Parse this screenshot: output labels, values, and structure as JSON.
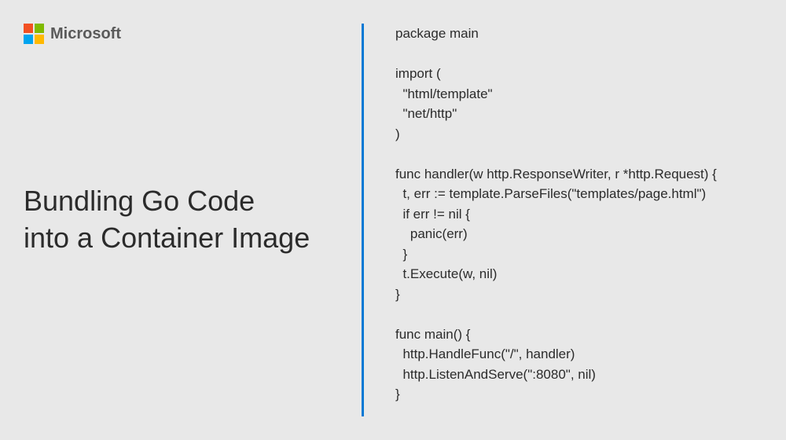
{
  "brand": {
    "name": "Microsoft",
    "colors": {
      "red": "#f25022",
      "green": "#7fba00",
      "blue": "#00a4ef",
      "yellow": "#ffb900"
    }
  },
  "slide": {
    "title": "Bundling Go Code\ninto a Container Image",
    "code": "package main\n\nimport (\n  \"html/template\"\n  \"net/http\"\n)\n\nfunc handler(w http.ResponseWriter, r *http.Request) {\n  t, err := template.ParseFiles(\"templates/page.html\")\n  if err != nil {\n    panic(err)\n  }\n  t.Execute(w, nil)\n}\n\nfunc main() {\n  http.HandleFunc(\"/\", handler)\n  http.ListenAndServe(\":8080\", nil)\n}"
  },
  "accent_color": "#0078d4"
}
